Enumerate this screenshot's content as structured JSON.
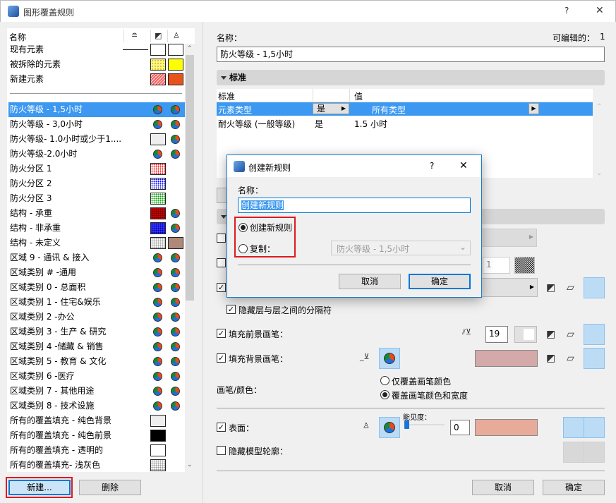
{
  "window": {
    "title": "图形覆盖规则",
    "help": "?",
    "close": "✕"
  },
  "list": {
    "header": {
      "name": "名称"
    },
    "legend_rows": [
      {
        "label": "现有元素"
      },
      {
        "label": "被拆除的元素"
      },
      {
        "label": "新建元素"
      }
    ],
    "rows": [
      {
        "label": "防火等级 - 1,5小时",
        "c1": "pen",
        "c2": "pen",
        "selected": true
      },
      {
        "label": "防火等级 - 3,0小时",
        "c1": "pen",
        "c2": "pen"
      },
      {
        "label": "防火等级- 1.0小时或少于1....",
        "c1": "#eeeeee",
        "c2": "pen"
      },
      {
        "label": "防火等级-2.0小时",
        "c1": "pen",
        "c2": "pen"
      },
      {
        "label": "防火分区 1",
        "c1": "dots-red",
        "c2": ""
      },
      {
        "label": "防火分区 2",
        "c1": "dots-blue",
        "c2": ""
      },
      {
        "label": "防火分区 3",
        "c1": "dots-green",
        "c2": ""
      },
      {
        "label": "结构 - 承重",
        "c1": "dots-darkred",
        "c2": "pen"
      },
      {
        "label": "结构 - 非承重",
        "c1": "dots-blue2",
        "c2": "pen"
      },
      {
        "label": "结构 - 未定义",
        "c1": "dots-gray",
        "c2": "#b0887a"
      },
      {
        "label": "区域 9 - 通讯 & 接入",
        "c1": "pen",
        "c2": "pen"
      },
      {
        "label": "区域类别 # -通用",
        "c1": "pen",
        "c2": "pen"
      },
      {
        "label": "区域类别 0 - 总面积",
        "c1": "pen",
        "c2": "pen"
      },
      {
        "label": "区域类别 1 - 住宅&娱乐",
        "c1": "pen",
        "c2": "pen"
      },
      {
        "label": "区域类别 2 -办公",
        "c1": "pen",
        "c2": "pen"
      },
      {
        "label": "区域类别 3 - 生产 & 研究",
        "c1": "pen",
        "c2": "pen"
      },
      {
        "label": "区域类别 4 -储藏 & 销售",
        "c1": "pen",
        "c2": "pen"
      },
      {
        "label": "区域类别 5 - 教育 & 文化",
        "c1": "pen",
        "c2": "pen"
      },
      {
        "label": "区域类别 6 -医疗",
        "c1": "pen",
        "c2": "pen"
      },
      {
        "label": "区域类别 7 - 其他用途",
        "c1": "pen",
        "c2": "pen"
      },
      {
        "label": "区域类别 8 - 技术设施",
        "c1": "pen",
        "c2": "pen"
      },
      {
        "label": "所有的覆盖填充 - 纯色背景",
        "c1": "#eeeeee",
        "c2": ""
      },
      {
        "label": "所有的覆盖填充 - 纯色前景",
        "c1": "#000000",
        "c2": ""
      },
      {
        "label": "所有的覆盖填充 - 透明的",
        "c1": "#ffffff",
        "c2": ""
      },
      {
        "label": "所有的覆盖填充- 浅灰色",
        "c1": "dots-gray",
        "c2": ""
      }
    ],
    "new_button": "新建...",
    "delete_button": "删除"
  },
  "right": {
    "name_label": "名称：",
    "editable_label": "可编辑的：",
    "editable_count": "1",
    "name_value": "防火等级 - 1,5小时",
    "criteria_section": "标准",
    "criteria_table": {
      "headers": [
        "标准",
        "",
        "值"
      ],
      "rows": [
        {
          "criterion": "元素类型",
          "op": "是",
          "value": "所有类型",
          "selected": true
        },
        {
          "criterion": "耐火等级 (一般等级)",
          "op": "是",
          "value": "1.5 小时"
        }
      ]
    },
    "hide_separator_label": "隐藏层与层之间的分隔符",
    "fill_fg_label": "填充前景画笔：",
    "fill_fg_pen": "19",
    "fill_bg_label": "填充背景画笔：",
    "fill_bg_color": "#d4a9a9",
    "pen_color_label": "画笔/颜色：",
    "pen_option_1": "仅覆盖画笔颜色",
    "pen_option_2": "覆盖画笔颜色和宽度",
    "surface_label": "表面：",
    "visibility_label": "能见度：",
    "visibility_value": "0",
    "surface_color": "#e8ab9a",
    "hide_model_contour_label": "隐藏模型轮廓：",
    "row2_value": "1",
    "cancel": "取消",
    "ok": "确定"
  },
  "dialog": {
    "title": "创建新规则",
    "help": "?",
    "close": "✕",
    "name_label": "名称：",
    "name_value": "创建新规则",
    "option_new": "创建新规则",
    "option_copy": "复制：",
    "copy_source": "防火等级 - 1,5小时",
    "cancel": "取消",
    "ok": "确定"
  }
}
